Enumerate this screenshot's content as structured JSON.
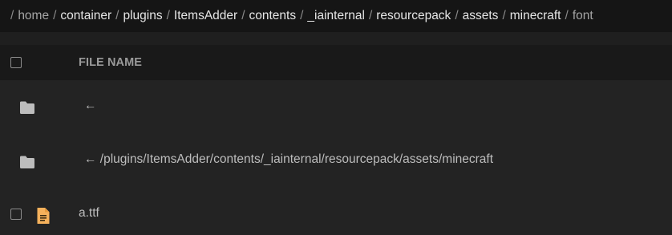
{
  "breadcrumb": {
    "separator": "/",
    "segments": [
      "home",
      "container",
      "plugins",
      "ItemsAdder",
      "contents",
      "_iainternal",
      "resourcepack",
      "assets",
      "minecraft",
      "font"
    ]
  },
  "table": {
    "header": {
      "file_name": "FILE NAME"
    },
    "rows": [
      {
        "name": "←",
        "type": "folder"
      },
      {
        "name": "← /plugins/ItemsAdder/contents/_iainternal/resourcepack/assets/minecraft",
        "type": "folder"
      },
      {
        "name": "a.ttf",
        "type": "file"
      }
    ]
  },
  "colors": {
    "background": "#1f1f1f",
    "breadcrumb_bg": "#151515",
    "folder_icon": "#bdbdbd",
    "file_icon": "#f5b15c"
  },
  "icons": {
    "folder": "folder-icon",
    "file": "file-icon"
  }
}
